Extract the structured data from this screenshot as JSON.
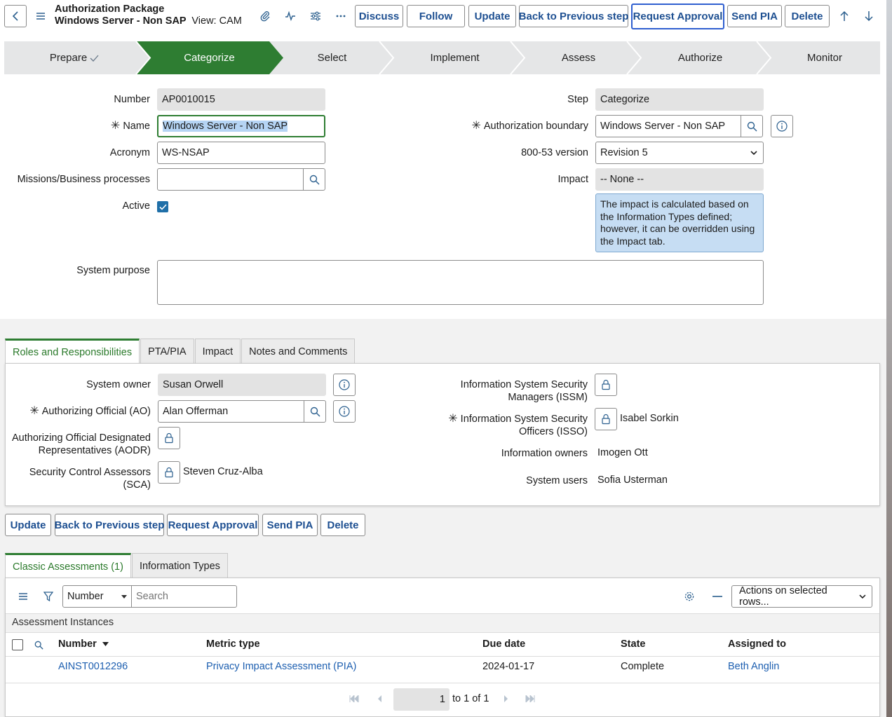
{
  "header": {
    "title_line1": "Authorization Package",
    "title_line2": "Windows Server - Non SAP",
    "view_label": "View: CAM",
    "buttons": {
      "discuss": "Discuss",
      "follow": "Follow",
      "update": "Update",
      "back": "Back to Previous step",
      "request_approval": "Request Approval",
      "send_pia": "Send PIA",
      "delete": "Delete"
    }
  },
  "steps": [
    {
      "label": "Prepare",
      "done": true
    },
    {
      "label": "Categorize",
      "active": true
    },
    {
      "label": "Select"
    },
    {
      "label": "Implement"
    },
    {
      "label": "Assess"
    },
    {
      "label": "Authorize"
    },
    {
      "label": "Monitor"
    }
  ],
  "colors": {
    "accent_green": "#2e7d32",
    "link_blue": "#1d5fb0",
    "info_box": "#c6ddf3"
  },
  "form": {
    "number_label": "Number",
    "number_value": "AP0010015",
    "name_label": "Name",
    "name_value": "Windows Server - Non SAP",
    "acronym_label": "Acronym",
    "acronym_value": "WS-NSAP",
    "missions_label": "Missions/Business processes",
    "missions_value": "",
    "active_label": "Active",
    "purpose_label": "System purpose",
    "purpose_value": "",
    "step_label": "Step",
    "step_value": "Categorize",
    "boundary_label": "Authorization boundary",
    "boundary_value": "Windows Server - Non SAP",
    "version_label": "800-53 version",
    "version_value": "Revision 5",
    "impact_label": "Impact",
    "impact_value": "-- None --",
    "impact_info": "The impact is calculated based on the Information Types defined; however, it can be overridden using the Impact tab."
  },
  "tabs1": [
    "Roles and Responsibilities",
    "PTA/PIA",
    "Impact",
    "Notes and Comments"
  ],
  "roles": {
    "system_owner_label": "System owner",
    "system_owner_value": "Susan Orwell",
    "ao_label": "Authorizing Official (AO)",
    "ao_value": "Alan Offerman",
    "aodr_label1": "Authorizing Official Designated",
    "aodr_label2": "Representatives (AODR)",
    "sca_label1": "Security Control Assessors",
    "sca_label2": "(SCA)",
    "sca_value": "Steven Cruz-Alba",
    "issm_label1": "Information System Security",
    "issm_label2": "Managers (ISSM)",
    "isso_label1": "Information System Security",
    "isso_label2": "Officers (ISSO)",
    "isso_value": "Isabel Sorkin",
    "owners_label": "Information owners",
    "owners_value": "Imogen Ott",
    "users_label": "System users",
    "users_value": "Sofia Usterman"
  },
  "bottom_buttons": {
    "update": "Update",
    "back": "Back to Previous step",
    "request_approval": "Request Approval",
    "send_pia": "Send PIA",
    "delete": "Delete"
  },
  "tabs2": [
    "Classic Assessments (1)",
    "Information Types"
  ],
  "list": {
    "filter_field": "Number",
    "search_placeholder": "Search",
    "actions_label": "Actions on selected rows...",
    "section_title": "Assessment Instances",
    "columns": [
      "Number",
      "Metric type",
      "Due date",
      "State",
      "Assigned to"
    ],
    "rows": [
      {
        "number": "AINST0012296",
        "metric": "Privacy Impact Assessment (PIA)",
        "due": "2024-01-17",
        "state": "Complete",
        "assigned": "Beth Anglin"
      }
    ],
    "pager_page": "1",
    "pager_text": "to 1 of 1"
  }
}
